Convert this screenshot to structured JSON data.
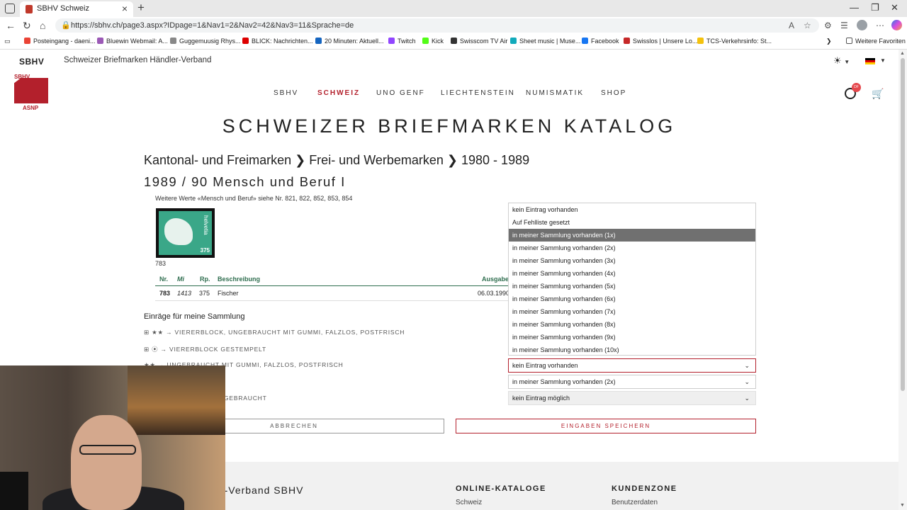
{
  "browser": {
    "tab_title": "SBHV Schweiz",
    "url": "https://sbhv.ch/page3.aspx?IDpage=1&Nav1=2&Nav2=42&Nav3=11&Sprache=de",
    "bookmarks": [
      "Posteingang - daeni...",
      "Bluewin Webmail: A...",
      "Guggemuusig Rhys...",
      "BLICK: Nachrichten...",
      "20 Minuten: Aktuell...",
      "Twitch",
      "Kick",
      "Swisscom TV Air",
      "Sheet music | Muse...",
      "Facebook",
      "Swisslos | Unsere Lo...",
      "TCS-Verkehrsinfo: St..."
    ],
    "favorites_label": "Weitere Favoriten"
  },
  "site": {
    "brand": "SBHV",
    "subtitle": "Schweizer Briefmarken Händler-Verband",
    "logo_top": "SBHV",
    "logo_bottom": "ASNP",
    "user_badge": "DF",
    "nav": [
      "SBHV",
      "SCHWEIZ",
      "UNO GENF",
      "LIECHTENSTEIN",
      "NUMISMATIK",
      "SHOP"
    ],
    "accent_color": "#b3202c"
  },
  "page": {
    "catalog_title": "SCHWEIZER BRIEFMARKEN KATALOG",
    "breadcrumb": "Kantonal- und Freimarken ❯ Frei- und Werbemarken ❯ 1980 - 1989",
    "series_title": "1989 / 90 Mensch und Beruf I",
    "note": "Weitere Werte «Mensch und Beruf» siehe Nr. 821, 822, 852, 853, 854",
    "stamp_number": "783",
    "stamp_text": "helvetia",
    "stamp_value": "375",
    "table": {
      "headers": [
        "Nr.",
        "Mi",
        "Rp.",
        "Beschreibung",
        "Ausgabe"
      ],
      "row": [
        "783",
        "1413",
        "375",
        "Fischer",
        "06.03.1990"
      ]
    },
    "collection_title": "Einräge für meine Sammlung",
    "collection_rows": [
      "⊞ ★★ → VIERERBLOCK, UNGEBRAUCHT MIT GUMMI, FALZLOS, POSTFRISCH",
      "⊞ ⦿ → VIERERBLOCK GESTEMPELT",
      "★★ → UNGEBRAUCHT MIT GUMMI, FALZLOS, POSTFRISCH",
      "GEBRAUCHT"
    ],
    "dropdown_options": [
      "kein Eintrag vorhanden",
      "Auf Fehlliste gesetzt",
      "in meiner Sammlung vorhanden (1x)",
      "in meiner Sammlung vorhanden (2x)",
      "in meiner Sammlung vorhanden (3x)",
      "in meiner Sammlung vorhanden (4x)",
      "in meiner Sammlung vorhanden (5x)",
      "in meiner Sammlung vorhanden (6x)",
      "in meiner Sammlung vorhanden (7x)",
      "in meiner Sammlung vorhanden (8x)",
      "in meiner Sammlung vorhanden (9x)",
      "in meiner Sammlung vorhanden (10x)"
    ],
    "selects": {
      "first": "kein Eintrag vorhanden",
      "second": "in meiner Sammlung vorhanden (2x)",
      "third": "kein Eintrag möglich"
    },
    "buttons": {
      "cancel": "ABBRECHEN",
      "save": "EINGABEN SPEICHERN"
    }
  },
  "footer": {
    "org": "marken Händler-Verband SBHV",
    "col1_heading": "ONLINE-KATALOGE",
    "col1_link": "Schweiz",
    "col2_heading": "KUNDENZONE",
    "col2_link": "Benutzerdaten"
  }
}
